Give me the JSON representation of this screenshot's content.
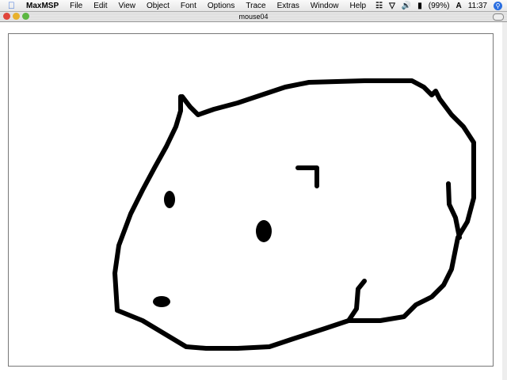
{
  "menubar": {
    "app": "MaxMSP",
    "items": [
      "File",
      "Edit",
      "View",
      "Object",
      "Font",
      "Options",
      "Trace",
      "Extras",
      "Window",
      "Help"
    ],
    "battery": "(99%)",
    "clock": "11:37"
  },
  "window": {
    "title": "mouse04"
  },
  "colors": {
    "ink": "#000000",
    "close": "#e0443a",
    "minimize": "#e8b12c",
    "zoom": "#5cb742"
  }
}
